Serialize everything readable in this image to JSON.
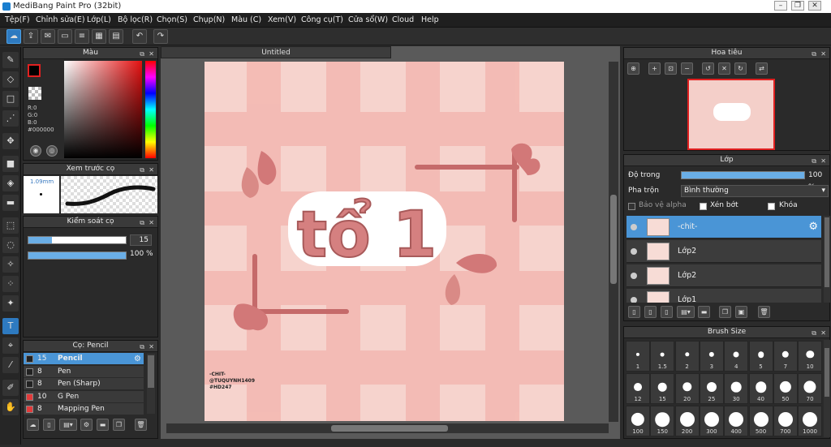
{
  "window": {
    "title": "MediBang Paint Pro (32bit)"
  },
  "menu": [
    "Tệp(F)",
    "Chỉnh sửa(E)",
    "Lớp(L)",
    "Bộ lọc(R)",
    "Chọn(S)",
    "Chụp(N)",
    "Màu (C)",
    "Xem(V)",
    "Công cụ(T)",
    "Cửa sổ(W)",
    "Cloud",
    "Help"
  ],
  "color_panel": {
    "title": "Màu",
    "r": "R:0",
    "g": "G:0",
    "b": "B:0",
    "hex": "#000000"
  },
  "brush_preview": {
    "title": "Xem trước cọ",
    "size": "1.09mm"
  },
  "brush_control": {
    "title": "Kiểm soát cọ",
    "size": "15",
    "opacity": "100 %",
    "size_fraction": 0.24,
    "opacity_fraction": 1.0
  },
  "brush_list": {
    "title": "Cọ: Pencil",
    "items": [
      {
        "size": "15",
        "name": "Pencil",
        "color": "#222222",
        "selected": true
      },
      {
        "size": "8",
        "name": "Pen",
        "color": "#222222",
        "selected": false
      },
      {
        "size": "8",
        "name": "Pen (Sharp)",
        "color": "#222222",
        "selected": false
      },
      {
        "size": "10",
        "name": "G Pen",
        "color": "#e23b3b",
        "selected": false
      },
      {
        "size": "8",
        "name": "Mapping Pen",
        "color": "#e23b3b",
        "selected": false
      }
    ]
  },
  "canvas": {
    "tab": "Untitled"
  },
  "artwork": {
    "title_text": "tổ 1",
    "credit": [
      "-CHIT-",
      "@TUQUYNH1409",
      "#HD247"
    ]
  },
  "navigator": {
    "title": "Hoa tiêu"
  },
  "layers": {
    "title": "Lớp",
    "opacity_label": "Độ trong",
    "opacity_value": "100 %",
    "opacity_fraction": 1.0,
    "blend_label": "Pha trộn",
    "blend_value": "Bình thường",
    "protect_alpha": "Bảo vệ alpha",
    "clipping": "Xén bớt",
    "lock": "Khóa",
    "items": [
      {
        "name": "-chit-",
        "selected": true
      },
      {
        "name": "Lớp2",
        "selected": false
      },
      {
        "name": "Lớp2",
        "selected": false
      },
      {
        "name": "Lớp1",
        "selected": false
      }
    ]
  },
  "brush_size": {
    "title": "Brush Size",
    "sizes": [
      "1",
      "1.5",
      "2",
      "3",
      "4",
      "5",
      "7",
      "10",
      "12",
      "15",
      "20",
      "25",
      "30",
      "40",
      "50",
      "70",
      "100",
      "150",
      "200",
      "300",
      "400",
      "500",
      "700",
      "1000"
    ]
  }
}
